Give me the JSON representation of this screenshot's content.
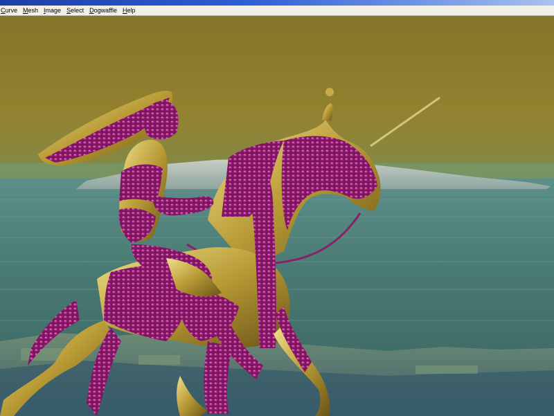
{
  "menubar": {
    "items": [
      {
        "label": "Curve",
        "accel": "C"
      },
      {
        "label": "Mesh",
        "accel": "M"
      },
      {
        "label": "Image",
        "accel": "I"
      },
      {
        "label": "Select",
        "accel": "S"
      },
      {
        "label": "Dogwaffle",
        "accel": "D"
      },
      {
        "label": "Help",
        "accel": "H"
      }
    ]
  },
  "colors": {
    "titlebar": "#2f5fd6",
    "sky": "#8e7c2e",
    "sea": "#4f7f78",
    "gold": "#c8b04a",
    "magenta": "#8a1f6a"
  },
  "icons": [
    "render-viewport"
  ]
}
